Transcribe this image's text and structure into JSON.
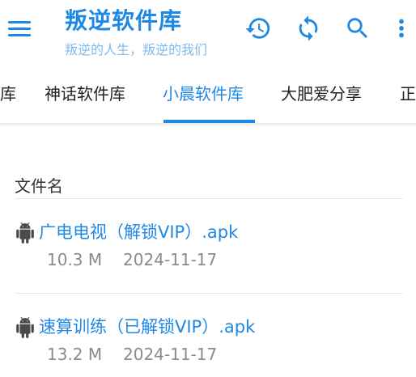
{
  "header": {
    "title": "叛逆软件库",
    "subtitle": "叛逆的人生，叛逆的我们",
    "icons": [
      "menu-icon",
      "history-icon",
      "refresh-icon",
      "search-icon",
      "more-vert-icon"
    ],
    "accent_color": "#1e88e5"
  },
  "tabs": [
    {
      "label": "库",
      "active": false
    },
    {
      "label": "神话软件库",
      "active": false
    },
    {
      "label": "小晨软件库",
      "active": true
    },
    {
      "label": "大肥爱分享",
      "active": false
    },
    {
      "label": "正",
      "active": false
    }
  ],
  "list": {
    "header": "文件名",
    "files": [
      {
        "name": "广电电视（解锁VIP）.apk",
        "size": "10.3 M",
        "date": "2024-11-17",
        "icon": "android-icon"
      },
      {
        "name": "速算训练（已解锁VIP）.apk",
        "size": "13.2 M",
        "date": "2024-11-17",
        "icon": "android-icon"
      }
    ]
  }
}
